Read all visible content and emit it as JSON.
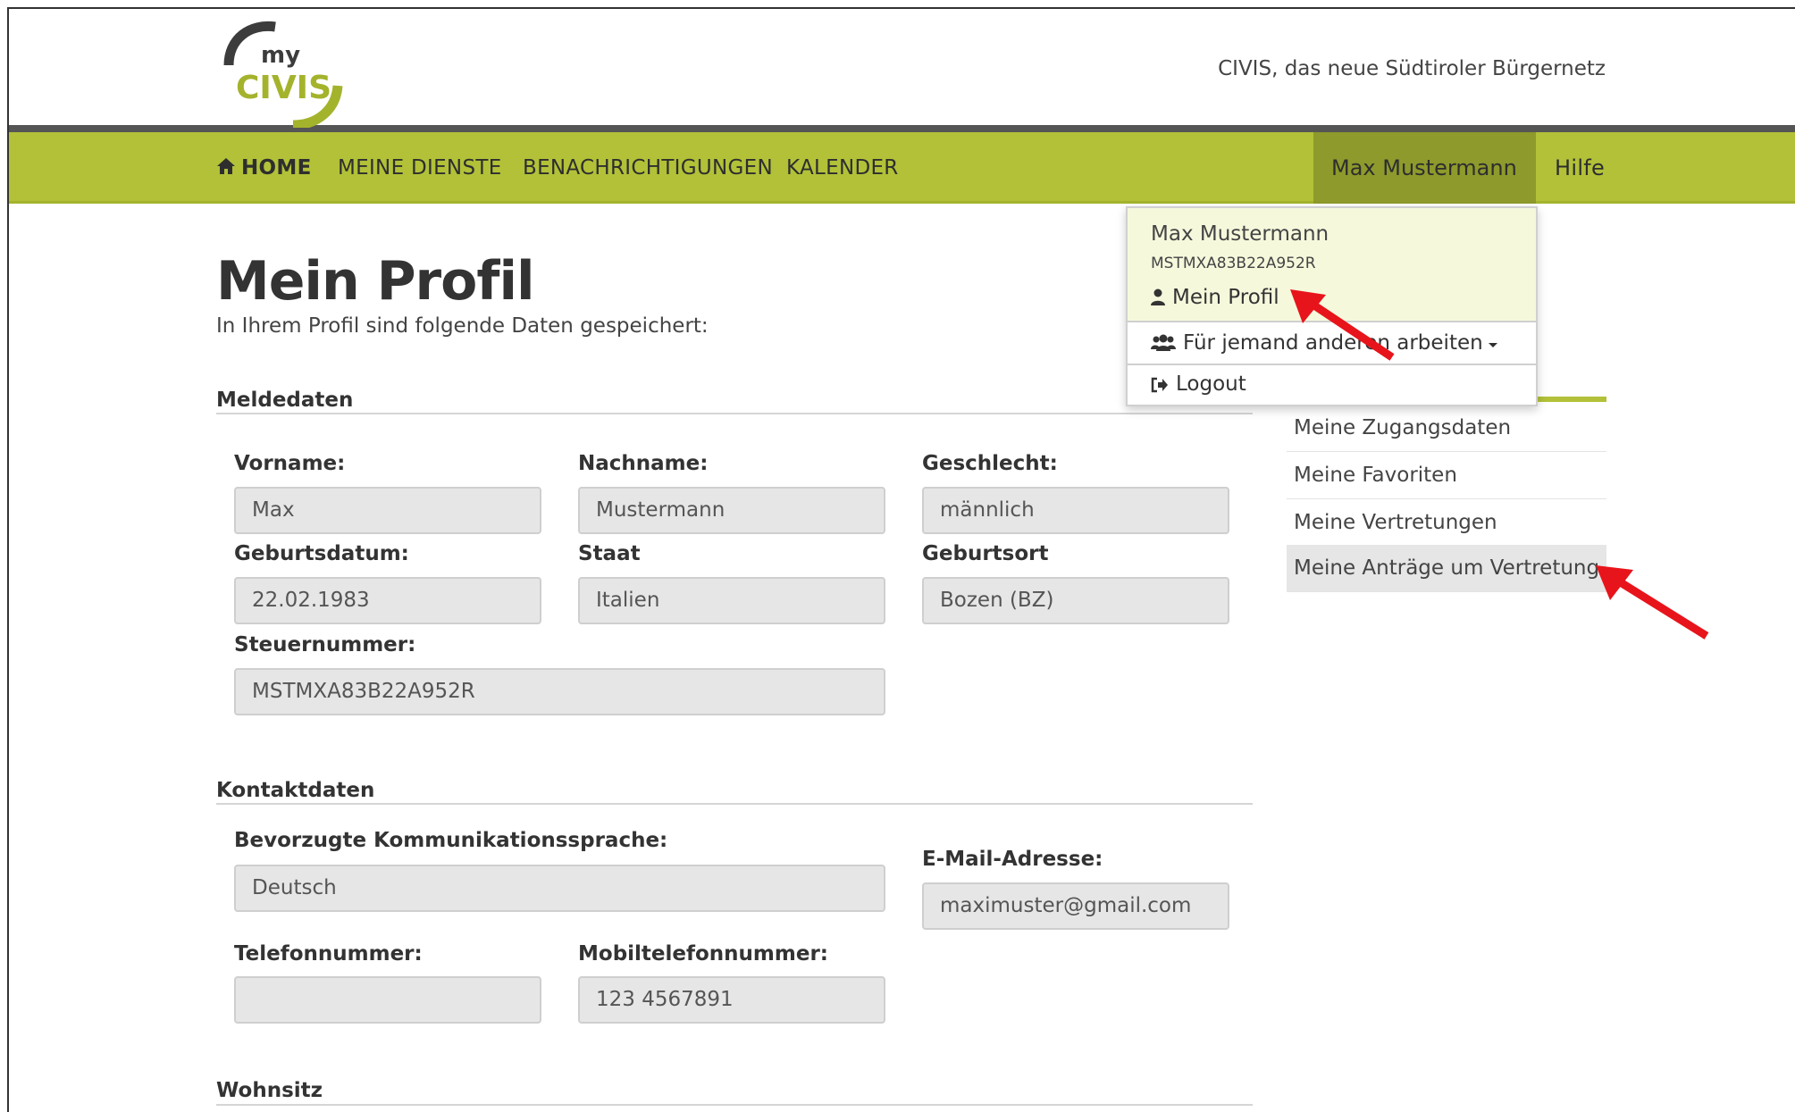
{
  "header": {
    "logo_top": "my",
    "logo_bottom": "CIVIS",
    "tagline": "CIVIS, das neue Südtiroler Bürgernetz"
  },
  "nav": {
    "home": "HOME",
    "dienste": "MEINE DIENSTE",
    "benachrichtigungen": "BENACHRICHTIGUNGEN",
    "kalender": "KALENDER",
    "user": "Max Mustermann",
    "help": "Hilfe"
  },
  "dropdown": {
    "name": "Max Mustermann",
    "code": "MSTMXA83B22A952R",
    "profile": "Mein Profil",
    "act_for_others": "Für jemand anderen arbeiten",
    "logout": "Logout"
  },
  "page": {
    "title": "Mein Profil",
    "subtitle": "In Ihrem Profil sind folgende Daten gespeichert:"
  },
  "meldedaten": {
    "heading": "Meldedaten",
    "vorname_label": "Vorname:",
    "vorname": "Max",
    "nachname_label": "Nachname:",
    "nachname": "Mustermann",
    "geschlecht_label": "Geschlecht:",
    "geschlecht": "männlich",
    "geburtsdatum_label": "Geburtsdatum:",
    "geburtsdatum": "22.02.1983",
    "staat_label": "Staat",
    "staat": "Italien",
    "geburtsort_label": "Geburtsort",
    "geburtsort": "Bozen (BZ)",
    "steuernummer_label": "Steuernummer:",
    "steuernummer": "MSTMXA83B22A952R"
  },
  "kontaktdaten": {
    "heading": "Kontaktdaten",
    "sprache_label": "Bevorzugte Kommunikationssprache:",
    "sprache": "Deutsch",
    "email_label": "E-Mail-Adresse:",
    "email": "maximuster@gmail.com",
    "telefon_label": "Telefonnummer:",
    "telefon": "",
    "mobil_label": "Mobiltelefonnummer:",
    "mobil": "123 4567891"
  },
  "wohnsitz": {
    "heading": "Wohnsitz"
  },
  "sidebar": {
    "items": [
      {
        "label": "Meine Zugangsdaten"
      },
      {
        "label": "Meine Favoriten"
      },
      {
        "label": "Meine Vertretungen"
      },
      {
        "label": "Meine Anträge um Vertretung"
      }
    ]
  },
  "colors": {
    "nav_bg": "#b2c138",
    "nav_user_bg": "#8e9a2b",
    "dropdown_top_bg": "#f6f8dc",
    "annotation_arrow": "#e8141b"
  }
}
